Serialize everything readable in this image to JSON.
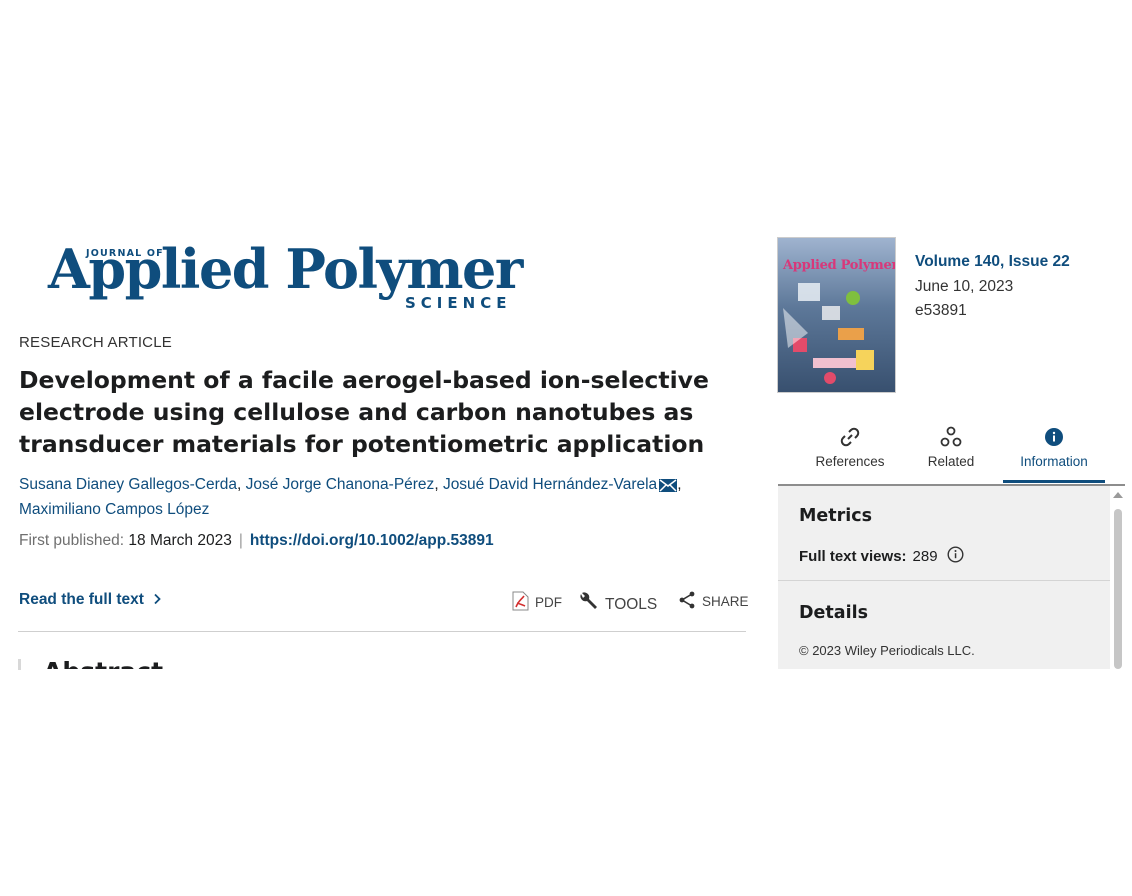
{
  "journal": {
    "small": "JOURNAL OF",
    "name": "Applied Polymer",
    "science": "SCIENCE"
  },
  "article": {
    "type": "RESEARCH ARTICLE",
    "title": "Development of a facile aerogel-based ion-selective electrode using cellulose and carbon nanotubes as transducer materials for potentiometric application",
    "authors": [
      "Susana Dianey Gallegos-Cerda",
      "José Jorge Chanona-Pérez",
      "Josué David Hernández-Varela",
      "Maximiliano Campos López"
    ],
    "author_sep": ",",
    "published_label": "First published:",
    "published_date": "18 March 2023",
    "pub_separator": "|",
    "doi": "https://doi.org/10.1002/app.53891"
  },
  "actions": {
    "read_full_text": "Read the full text",
    "pdf": "PDF",
    "tools": "TOOLS",
    "share": "SHARE"
  },
  "abstract_heading": "Abstract",
  "issue": {
    "cover_title": "Applied Polymer",
    "volume": "Volume 140, Issue 22",
    "date": "June 10, 2023",
    "article_id": "e53891"
  },
  "tabs": [
    {
      "label": "References",
      "icon": "link-icon"
    },
    {
      "label": "Related",
      "icon": "related-icon"
    },
    {
      "label": "Information",
      "icon": "info-icon"
    }
  ],
  "panel": {
    "metrics_heading": "Metrics",
    "views_label": "Full text views:",
    "views_value": "289",
    "details_heading": "Details",
    "copyright": "© 2023 Wiley Periodicals LLC."
  },
  "colors": {
    "brand": "#0f4d7d",
    "text": "#1c1d1e",
    "panel_bg": "#f0f0f0",
    "pdf_red": "#d32f2f"
  }
}
